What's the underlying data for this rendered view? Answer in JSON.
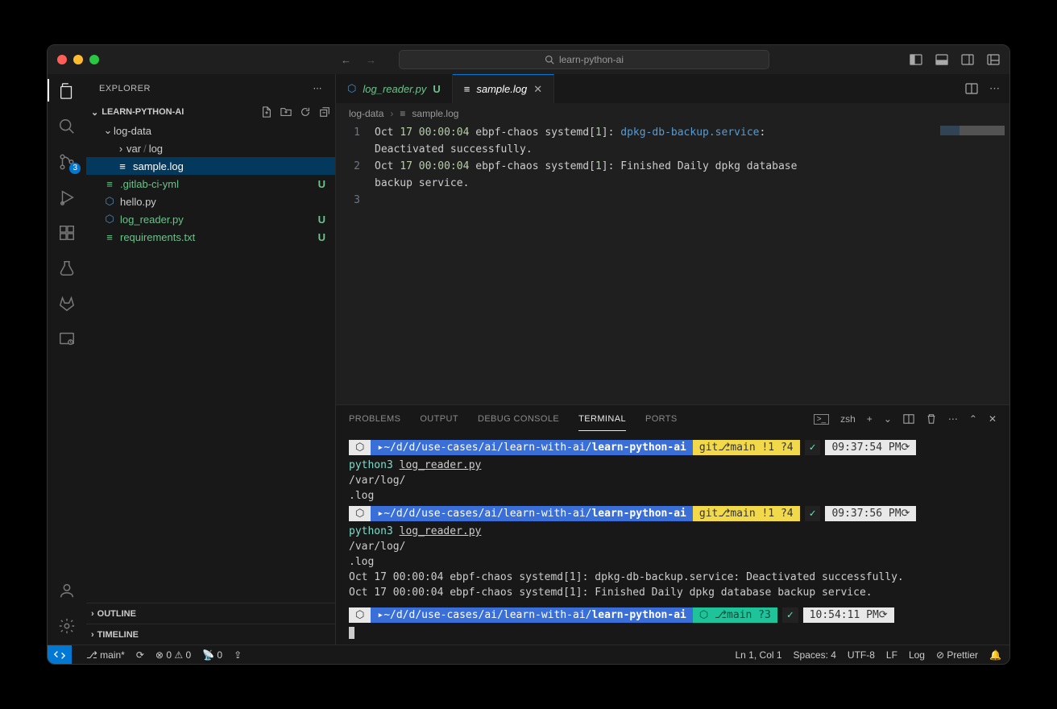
{
  "titlebar": {
    "search_text": "learn-python-ai"
  },
  "activity_bar": {
    "scm_badge": "3"
  },
  "explorer": {
    "title": "EXPLORER",
    "workspace": "LEARN-PYTHON-AI",
    "tree": {
      "folder1": "log-data",
      "folder2": "var",
      "folder2b": "log",
      "file_sample": "sample.log",
      "file_gitlab": ".gitlab-ci-yml",
      "file_hello": "hello.py",
      "file_reader": "log_reader.py",
      "file_req": "requirements.txt",
      "status_u": "U"
    },
    "outline": "OUTLINE",
    "timeline": "TIMELINE"
  },
  "tabs": {
    "t1": "log_reader.py",
    "t1_mod": "U",
    "t2": "sample.log"
  },
  "breadcrumbs": {
    "b1": "log-data",
    "b2": "sample.log"
  },
  "editor": {
    "ln1": "1",
    "ln2": "2",
    "ln3": "3",
    "l1a": "Oct ",
    "l1b": "17",
    "l1c": " 00:00:04",
    "l1d": " ebpf-chaos systemd[",
    "l1e": "1",
    "l1f": "]: ",
    "l1g": "dpkg-db-backup.service",
    "l1h": ":",
    "l1i": "Deactivated successfully.",
    "l2a": "Oct ",
    "l2b": "17",
    "l2c": " 00:00:04",
    "l2d": " ebpf-chaos systemd[",
    "l2e": "1",
    "l2f": "]: Finished Daily dpkg database",
    "l2g": "backup service."
  },
  "panel": {
    "problems": "PROBLEMS",
    "output": "OUTPUT",
    "debug": "DEBUG CONSOLE",
    "terminal": "TERMINAL",
    "ports": "PORTS",
    "shell": "zsh"
  },
  "terminal": {
    "path_prefix": "~/d/d/use-cases/ai/learn-with-ai/",
    "path_bold": "learn-python-ai",
    "branch_yellow": "main !1 ?4",
    "branch_green": "main ?3",
    "check": "✓",
    "time1": "09:37:54 PM",
    "time2": "09:37:56 PM",
    "time3": "10:54:11 PM",
    "cmd_py": "python3 ",
    "cmd_file": "log_reader.py",
    "out1": "/var/log/",
    "out2": ".log",
    "out3": "Oct 17 00:00:04 ebpf-chaos systemd[1]: dpkg-db-backup.service: Deactivated successfully.",
    "out4": "Oct 17 00:00:04 ebpf-chaos systemd[1]: Finished Daily dpkg database backup service.",
    "git_label": "git"
  },
  "statusbar": {
    "branch": "main*",
    "errors": "0",
    "warnings": "0",
    "ports": "0",
    "ln_col": "Ln 1, Col 1",
    "spaces": "Spaces: 4",
    "encoding": "UTF-8",
    "eol": "LF",
    "lang": "Log",
    "prettier": "Prettier"
  }
}
